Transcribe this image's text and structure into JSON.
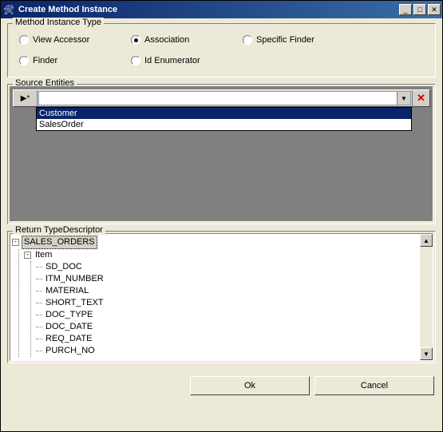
{
  "window": {
    "title": "Create Method Instance"
  },
  "method_type": {
    "label": "Method Instance Type",
    "options": [
      {
        "label": "View Accessor",
        "selected": false
      },
      {
        "label": "Association",
        "selected": true
      },
      {
        "label": "Specific Finder",
        "selected": false
      },
      {
        "label": "Finder",
        "selected": false
      },
      {
        "label": "Id Enumerator",
        "selected": false
      }
    ]
  },
  "source_entities": {
    "label": "Source Entities",
    "current_value": "",
    "items": [
      {
        "label": "Customer",
        "selected": true
      },
      {
        "label": "SalesOrder",
        "selected": false
      }
    ]
  },
  "return_type": {
    "label": "Return TypeDescriptor",
    "root": {
      "label": "SALES_ORDERS",
      "expanded": true,
      "children": [
        {
          "label": "Item",
          "expanded": true,
          "children": [
            {
              "label": "SD_DOC"
            },
            {
              "label": "ITM_NUMBER"
            },
            {
              "label": "MATERIAL"
            },
            {
              "label": "SHORT_TEXT"
            },
            {
              "label": "DOC_TYPE"
            },
            {
              "label": "DOC_DATE"
            },
            {
              "label": "REQ_DATE"
            },
            {
              "label": "PURCH_NO"
            }
          ]
        }
      ]
    }
  },
  "buttons": {
    "ok": "Ok",
    "cancel": "Cancel"
  }
}
